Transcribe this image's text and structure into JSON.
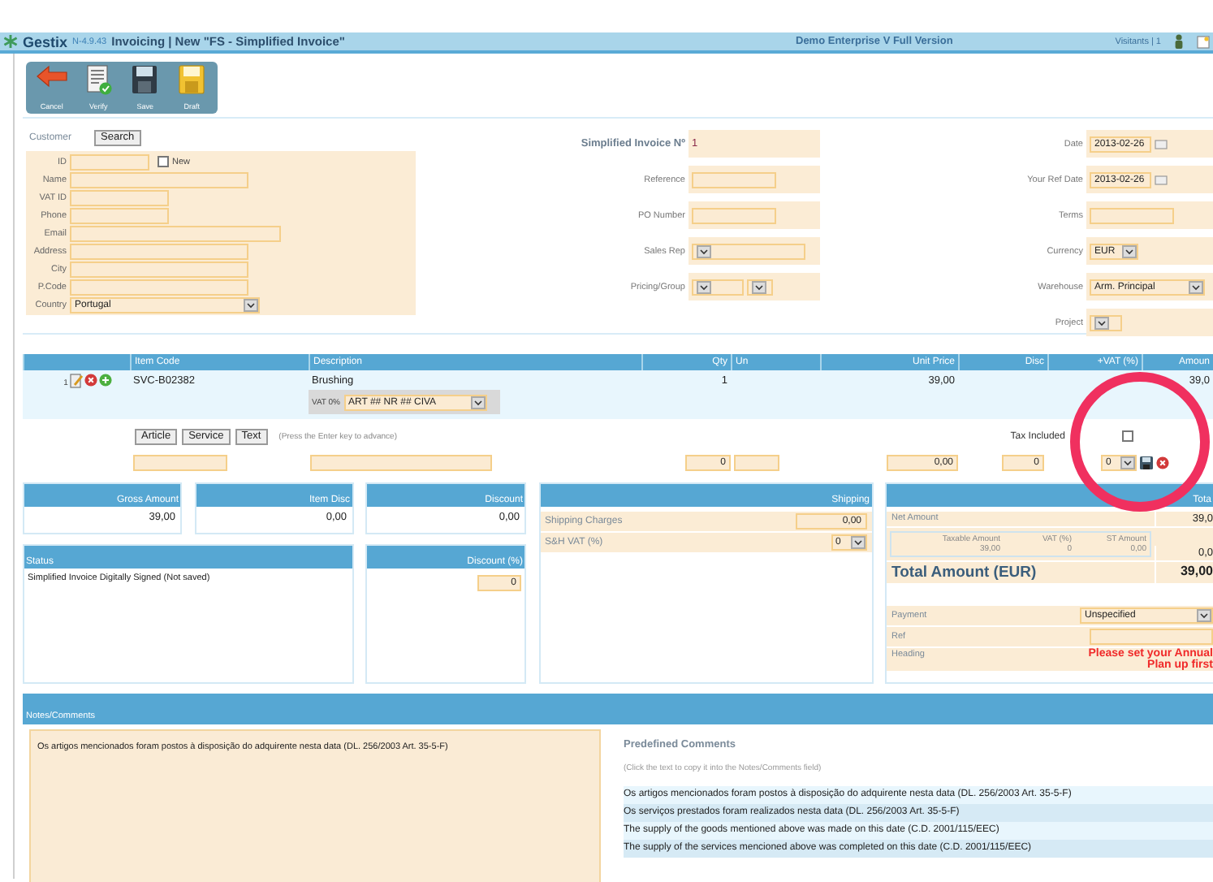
{
  "header": {
    "app": "Gestix",
    "version": "N-4.9.43",
    "title": "Invoicing | New \"FS - Simplified Invoice\"",
    "edition": "Demo Enterprise V Full Version",
    "visitors": "Visitants | 1"
  },
  "toolbar": [
    {
      "label": "Cancel",
      "kind": "cancel"
    },
    {
      "label": "Verify",
      "kind": "verify"
    },
    {
      "label": "Save",
      "kind": "save"
    },
    {
      "label": "Draft",
      "kind": "draft"
    }
  ],
  "customer": {
    "label": "Customer",
    "search": "Search",
    "new_label": "New",
    "new_checked": false,
    "fields": [
      {
        "label": "ID",
        "kind": "id"
      },
      {
        "label": "Name",
        "kind": "long"
      },
      {
        "label": "VAT ID",
        "kind": "short"
      },
      {
        "label": "Phone",
        "kind": "short"
      },
      {
        "label": "Email",
        "kind": "wide"
      },
      {
        "label": "Address",
        "kind": "long"
      },
      {
        "label": "City",
        "kind": "long"
      },
      {
        "label": "P.Code",
        "kind": "long"
      },
      {
        "label": "Country",
        "kind": "select",
        "value": "Portugal"
      }
    ]
  },
  "document": [
    {
      "label": "Simplified Invoice Nº",
      "kind": "value",
      "value": "1"
    },
    {
      "label": "Reference",
      "kind": "input"
    },
    {
      "label": "PO Number",
      "kind": "input"
    },
    {
      "label": "Sales Rep",
      "kind": "select"
    },
    {
      "label": "Pricing/Group",
      "kind": "double_select"
    }
  ],
  "details": [
    {
      "label": "Date",
      "kind": "date",
      "value": "2013-02-26"
    },
    {
      "label": "Your Ref Date",
      "kind": "date",
      "value": "2013-02-26"
    },
    {
      "label": "Terms",
      "kind": "input"
    },
    {
      "label": "Currency",
      "kind": "small_select",
      "value": "EUR"
    },
    {
      "label": "Warehouse",
      "kind": "select",
      "value": "Arm. Principal"
    },
    {
      "label": "Project",
      "kind": "tiny_select"
    }
  ],
  "items": {
    "columns": [
      "Item Code",
      "Description",
      "Qty",
      "Un",
      "Unit Price",
      "Disc",
      "+VAT (%)",
      "Amoun"
    ],
    "rows": [
      {
        "number": "1",
        "code": "SVC-B02382",
        "description": "Brushing",
        "qty": "1",
        "unit_price": "39,00",
        "amount": "39,0",
        "vat_label": "VAT 0%",
        "vat_reason": "ART ## NR ## CIVA"
      }
    ]
  },
  "entry": {
    "buttons": [
      "Article",
      "Service",
      "Text"
    ],
    "hint": "(Press the Enter key to advance)",
    "tax_included": {
      "label": "Tax Included",
      "checked": false
    },
    "qty": "0",
    "unit_price": "0,00",
    "disc": "0",
    "vat": "0"
  },
  "summary": [
    {
      "label": "Gross Amount",
      "value": "39,00"
    },
    {
      "label": "Item Disc",
      "value": "0,00"
    },
    {
      "label": "Discount",
      "value": "0,00"
    }
  ],
  "shipping": {
    "label": "Shipping",
    "charges_label": "Shipping Charges",
    "charges": "0,00",
    "vat_label": "S&H VAT (%)",
    "vat": "0"
  },
  "status": {
    "label": "Status",
    "text": "Simplified Invoice Digitally Signed (Not saved)"
  },
  "discount_percent": {
    "label": "Discount (%)",
    "value": "0"
  },
  "totals": {
    "label": "Tota",
    "net_label": "Net Amount",
    "net": "39,0",
    "tax_columns": [
      "Taxable Amount",
      "VAT (%)",
      "ST Amount"
    ],
    "tax_row": [
      "39,00",
      "0",
      "0,00"
    ],
    "tax_total": "0,0",
    "total_label": "Total Amount (EUR)",
    "total": "39,00",
    "payment_label": "Payment",
    "payment": "Unspecified",
    "ref_label": "Ref",
    "heading_label": "Heading",
    "warning": [
      "Please set your Annual",
      "Plan up first"
    ]
  },
  "notes": {
    "label": "Notes/Comments",
    "text": "Os artigos mencionados foram postos à disposição do adquirente nesta data (DL. 256/2003 Art. 35-5-F)"
  },
  "predefined": {
    "title": "Predefined Comments",
    "hint": "(Click the text to copy it into the Notes/Comments field)",
    "items": [
      "Os artigos mencionados foram postos à disposição do adquirente nesta data (DL. 256/2003 Art. 35-5-F)",
      "Os serviços prestados foram realizados nesta data (DL. 256/2003 Art. 35-5-F)",
      "The supply of the goods mentioned above was made on this date (C.D. 2001/115/EEC)",
      "The supply of the services mencioned above was completed on this date (C.D. 2001/115/EEC)"
    ]
  },
  "highlight_ring": true
}
